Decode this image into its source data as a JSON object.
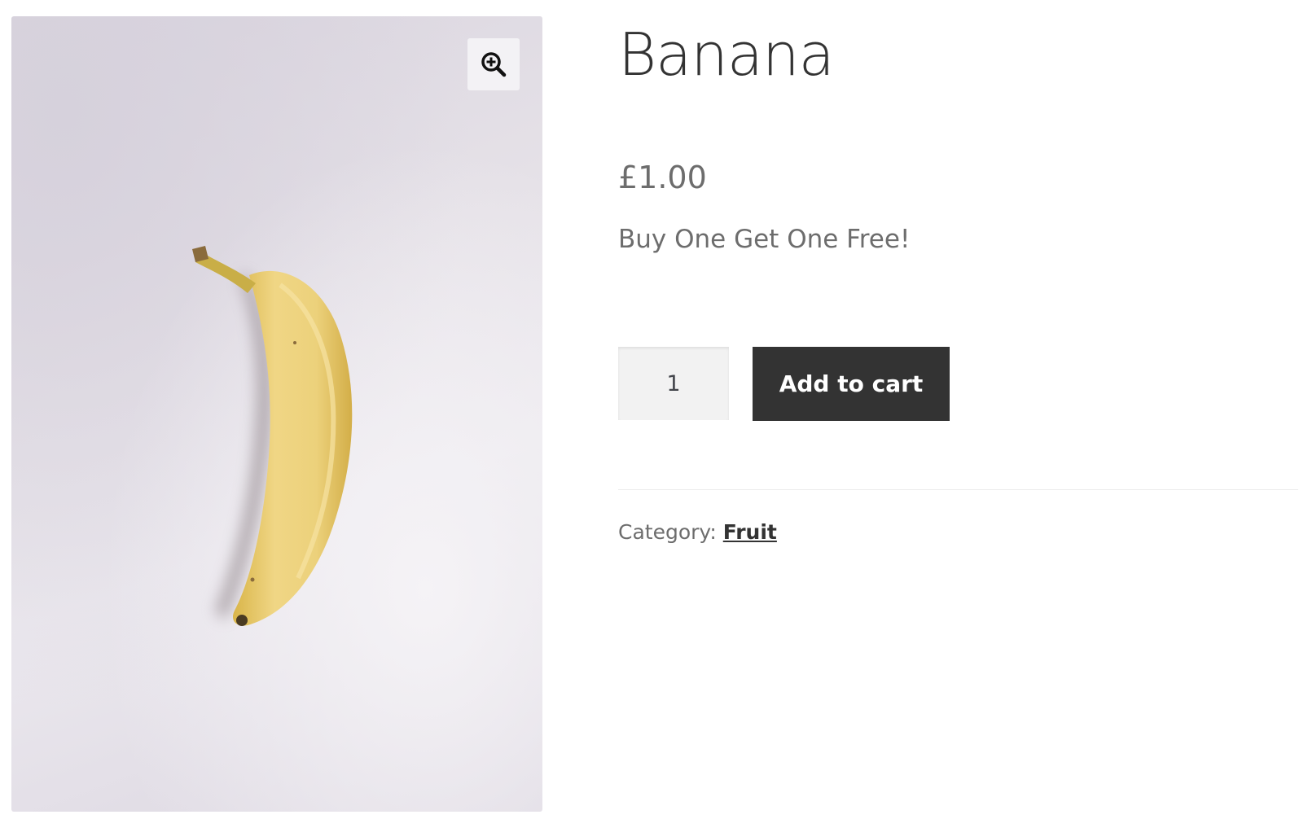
{
  "product": {
    "title": "Banana",
    "price": "£1.00",
    "short_description": "Buy One Get One Free!",
    "quantity": "1",
    "add_to_cart_label": "Add to cart",
    "category_label": "Category: ",
    "category_name": "Fruit"
  },
  "gallery": {
    "zoom_icon": "zoom-in-icon",
    "image_subject": "banana-image"
  },
  "colors": {
    "button_bg": "#333333",
    "button_text": "#ffffff",
    "body_text": "#6d6d6d",
    "heading_text": "#333333"
  }
}
